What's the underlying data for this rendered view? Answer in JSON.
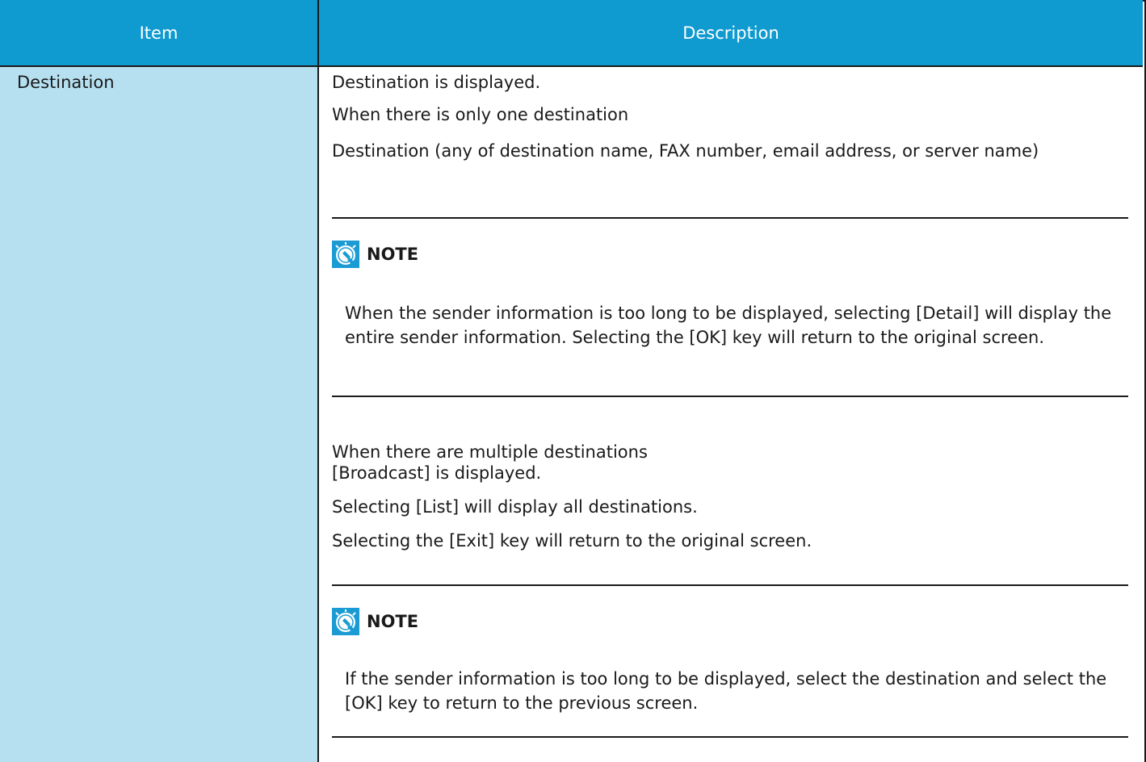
{
  "table": {
    "headers": {
      "item": "Item",
      "description": "Description"
    },
    "row": {
      "item": "Destination",
      "lines_single": [
        "Destination is displayed.",
        "When there is only one destination",
        "Destination (any of destination name, FAX number, email address, or server name)"
      ],
      "note_1": {
        "label": "NOTE",
        "icon": "lightbulb-hand-icon",
        "text": "When the sender information is too long to be displayed, selecting [Detail] will display the entire sender information. Selecting the [OK] key will return to the original screen."
      },
      "lines_multiple": [
        "When there are multiple destinations",
        "[Broadcast] is displayed.",
        "Selecting [List] will display all destinations.",
        "Selecting the [Exit] key will return to the original screen."
      ],
      "note_2": {
        "label": "NOTE",
        "icon": "lightbulb-hand-icon",
        "text": "If the sender information is too long to be displayed, select the destination and select the [OK] key to return to the previous screen."
      }
    }
  },
  "colors": {
    "header_bg": "#0f9ad0",
    "item_cell_bg": "#b6e0f0",
    "border": "#1a1a1a"
  }
}
